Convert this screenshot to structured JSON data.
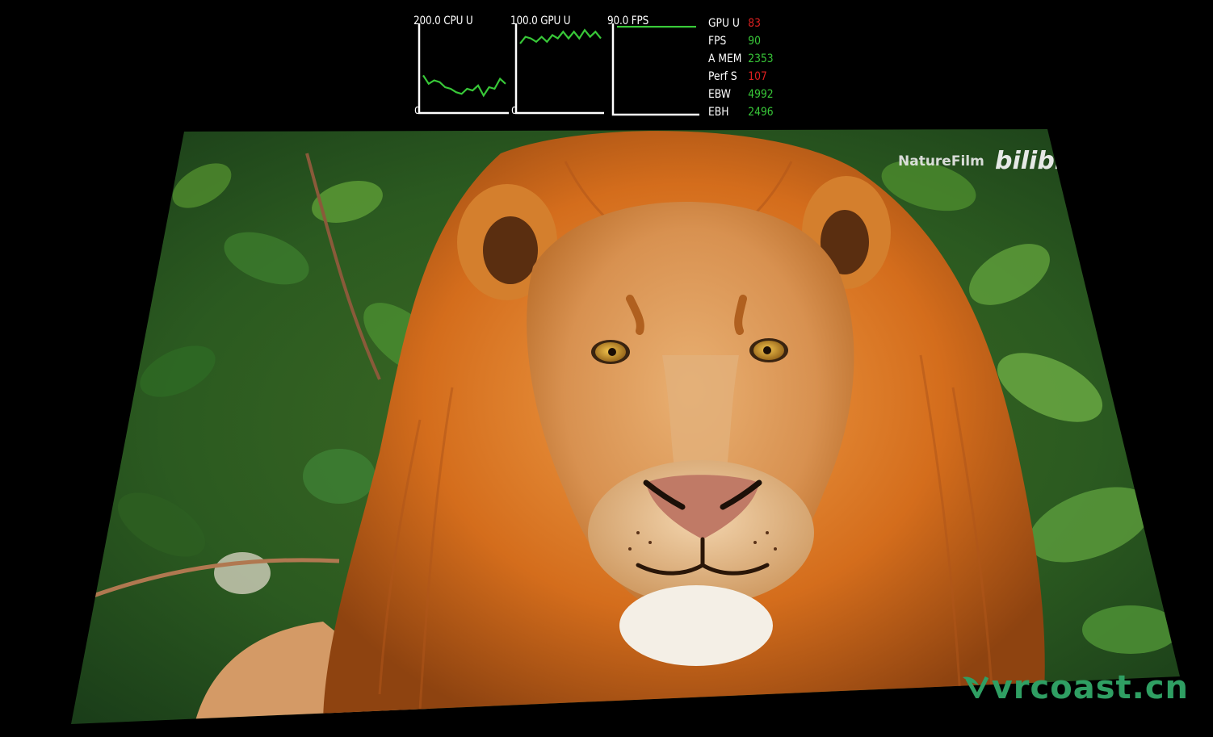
{
  "graphs": [
    {
      "id": "cpu",
      "title": "200.0 CPU U",
      "zero": "0",
      "color": "#38c838",
      "values": [
        40,
        30,
        34,
        32,
        26,
        24,
        20,
        18,
        24,
        22,
        28,
        16,
        26,
        24,
        36,
        30
      ]
    },
    {
      "id": "gpu",
      "title": "100.0 GPU U",
      "zero": "0",
      "color": "#38c838",
      "values": [
        78,
        86,
        84,
        80,
        86,
        80,
        88,
        84,
        92,
        84,
        92,
        84,
        94,
        86,
        92,
        84
      ]
    },
    {
      "id": "fps",
      "title": "90.0 FPS",
      "zero": "",
      "color": "#38c838",
      "values": [
        98,
        98,
        98,
        98,
        98,
        98,
        98,
        98,
        98,
        98,
        98,
        98,
        98,
        98,
        98,
        98
      ]
    }
  ],
  "stats": [
    {
      "label": "GPU U",
      "value": "83",
      "color": "#e02020"
    },
    {
      "label": "FPS",
      "value": "90",
      "color": "#38c838"
    },
    {
      "label": "A MEM",
      "value": "2353",
      "color": "#38c838"
    },
    {
      "label": "Perf S",
      "value": "107",
      "color": "#e02020"
    },
    {
      "label": "EBW",
      "value": "4992",
      "color": "#38c838"
    },
    {
      "label": "EBH",
      "value": "2496",
      "color": "#38c838"
    }
  ],
  "video": {
    "channel_text": "NatureFilm",
    "logo_text": "bilibili"
  },
  "watermark": {
    "text": "vrcoast.cn"
  },
  "colors": {
    "overlay_green": "#38c838",
    "overlay_red": "#e02020",
    "watermark": "#2f9f63"
  }
}
